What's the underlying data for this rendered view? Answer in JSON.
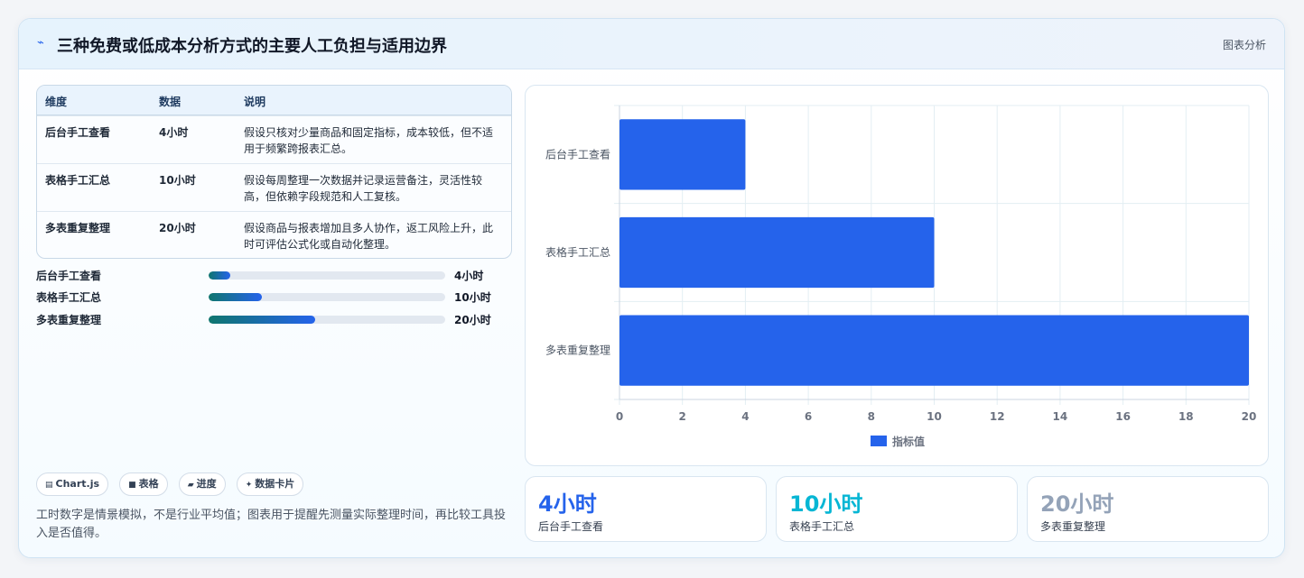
{
  "header": {
    "title": "三种免费或低成本分析方式的主要人工负担与适用边界",
    "tag": "图表分析",
    "icon": "chart-icon"
  },
  "table": {
    "headers": [
      "维度",
      "数据",
      "说明"
    ],
    "rows": [
      {
        "dim": "后台手工查看",
        "data": "4小时",
        "desc": "假设只核对少量商品和固定指标，成本较低，但不适用于频繁跨报表汇总。"
      },
      {
        "dim": "表格手工汇总",
        "data": "10小时",
        "desc": "假设每周整理一次数据并记录运营备注，灵活性较高，但依赖字段规范和人工复核。"
      },
      {
        "dim": "多表重复整理",
        "data": "20小时",
        "desc": "假设商品与报表增加且多人协作，返工风险上升，此时可评估公式化或自动化整理。"
      }
    ]
  },
  "progress": {
    "max": 20,
    "items": [
      {
        "label": "后台手工查看",
        "value": 4,
        "value_text": "4小时"
      },
      {
        "label": "表格手工汇总",
        "value": 10,
        "value_text": "10小时"
      },
      {
        "label": "多表重复整理",
        "value": 20,
        "value_text": "20小时"
      }
    ]
  },
  "chips": [
    {
      "icon": "bar-chart-icon",
      "glyph": "▤",
      "label": "Chart.js"
    },
    {
      "icon": "table-icon",
      "glyph": "■",
      "label": "表格"
    },
    {
      "icon": "progress-icon",
      "glyph": "▰",
      "label": "进度"
    },
    {
      "icon": "sparkle-icon",
      "glyph": "✦",
      "label": "数据卡片"
    }
  ],
  "note": "工时数字是情景模拟，不是行业平均值；图表用于提醒先测量实际整理时间，再比较工具投入是否值得。",
  "stats": [
    {
      "value": "4小时",
      "label": "后台手工查看",
      "color": "#2563eb"
    },
    {
      "value": "10小时",
      "label": "表格手工汇总",
      "color": "#06b6d4"
    },
    {
      "value": "20小时",
      "label": "多表重复整理",
      "color": "#94a3b8"
    }
  ],
  "chart_data": {
    "type": "bar",
    "orientation": "horizontal",
    "categories": [
      "后台手工查看",
      "表格手工汇总",
      "多表重复整理"
    ],
    "series": [
      {
        "name": "指标值",
        "values": [
          4,
          10,
          20
        ],
        "color": "#2563eb"
      }
    ],
    "xlim": [
      0,
      20
    ],
    "xticks": [
      0,
      2,
      4,
      6,
      8,
      10,
      12,
      14,
      16,
      18,
      20
    ],
    "grid": true,
    "legend": "bottom"
  }
}
